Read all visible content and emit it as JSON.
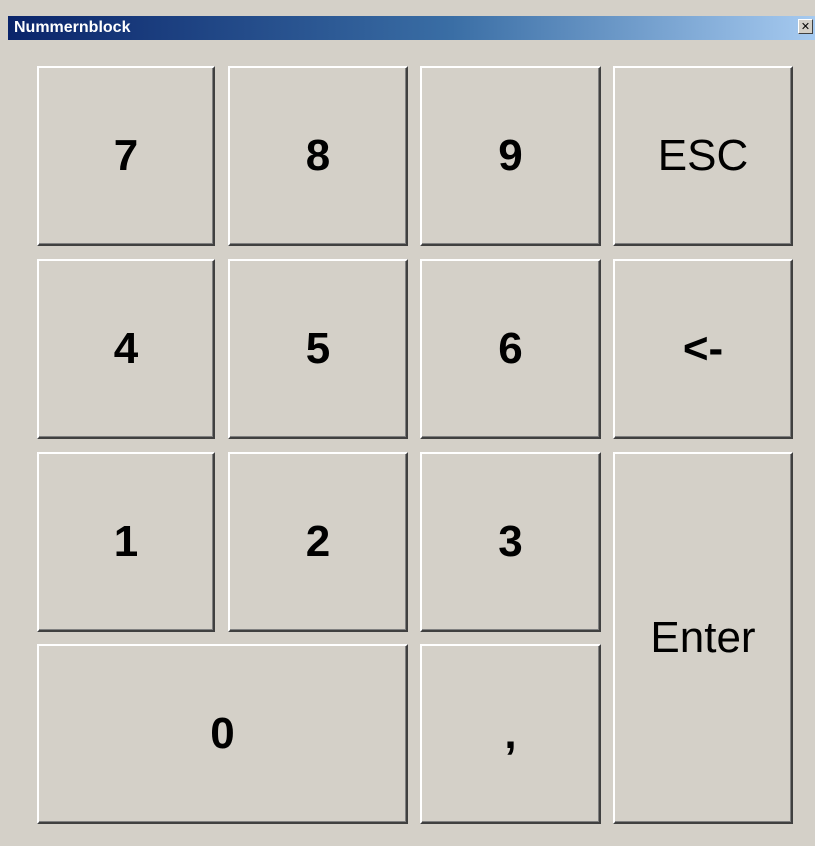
{
  "window": {
    "title": "Nummernblock",
    "close_glyph": "✕"
  },
  "keypad": {
    "seven": "7",
    "eight": "8",
    "nine": "9",
    "esc": "ESC",
    "four": "4",
    "five": "5",
    "six": "6",
    "backspace": "<-",
    "one": "1",
    "two": "2",
    "three": "3",
    "enter": "Enter",
    "zero": "0",
    "comma": ","
  },
  "colors": {
    "face": "#d4d0c8",
    "title_start": "#0a246a",
    "title_end": "#a6caf0"
  }
}
